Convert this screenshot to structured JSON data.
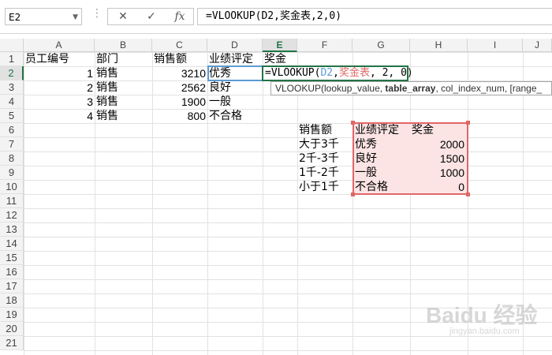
{
  "formula_bar": {
    "name_box": "E2",
    "cancel_icon": "✕",
    "enter_icon": "✓",
    "fx_label": "fx",
    "formula_prefix": "=VLOOKUP(",
    "formula_ref1": "D2",
    "formula_comma1": ",",
    "formula_ref2": "奖金表",
    "formula_rest": ",2,0)"
  },
  "columns": [
    "A",
    "B",
    "C",
    "D",
    "E",
    "F",
    "G",
    "H",
    "I",
    "J"
  ],
  "rows": [
    "1",
    "2",
    "3",
    "4",
    "5",
    "6",
    "7",
    "8",
    "9",
    "10",
    "11",
    "12",
    "13",
    "14",
    "15",
    "16",
    "17",
    "18",
    "19",
    "20",
    "21"
  ],
  "active_cell": {
    "column": "E",
    "row": "2"
  },
  "employee_table": {
    "headers": {
      "id": "员工编号",
      "dept": "部门",
      "sales": "销售额",
      "rating": "业绩评定",
      "bonus": "奖金"
    },
    "rows": [
      {
        "id": "1",
        "dept": "销售",
        "sales": "3210",
        "rating": "优秀"
      },
      {
        "id": "2",
        "dept": "销售",
        "sales": "2562",
        "rating": "良好"
      },
      {
        "id": "3",
        "dept": "销售",
        "sales": "1900",
        "rating": "一般"
      },
      {
        "id": "4",
        "dept": "销售",
        "sales": "800",
        "rating": "不合格"
      }
    ]
  },
  "editing": {
    "prefix": "=VLOOKUP(",
    "ref1": "D2",
    "comma1": ",",
    "ref2": "奖金表",
    "rest": ", 2, 0)"
  },
  "tooltip": {
    "func": "VLOOKUP(",
    "arg1": "lookup_value, ",
    "arg2": "table_array",
    "arg_rest": ", col_index_num, [range_"
  },
  "bonus_table": {
    "header_sales": "销售额",
    "header_rating": "业绩评定",
    "header_bonus": "奖金",
    "rows": [
      {
        "sales": "大于3千",
        "rating": "优秀",
        "bonus": "2000"
      },
      {
        "sales": "2千-3千",
        "rating": "良好",
        "bonus": "1500"
      },
      {
        "sales": "1千-2千",
        "rating": "一般",
        "bonus": "1000"
      },
      {
        "sales": "小于1千",
        "rating": "不合格",
        "bonus": "0"
      }
    ]
  },
  "colors": {
    "accent_green": "#217346",
    "ref_blue": "#5b9bd5",
    "ref_red": "#e06666",
    "range_fill": "#fce4e4"
  },
  "watermark": {
    "main": "Baidu 经验",
    "sub": "jingyan.baidu.com"
  }
}
